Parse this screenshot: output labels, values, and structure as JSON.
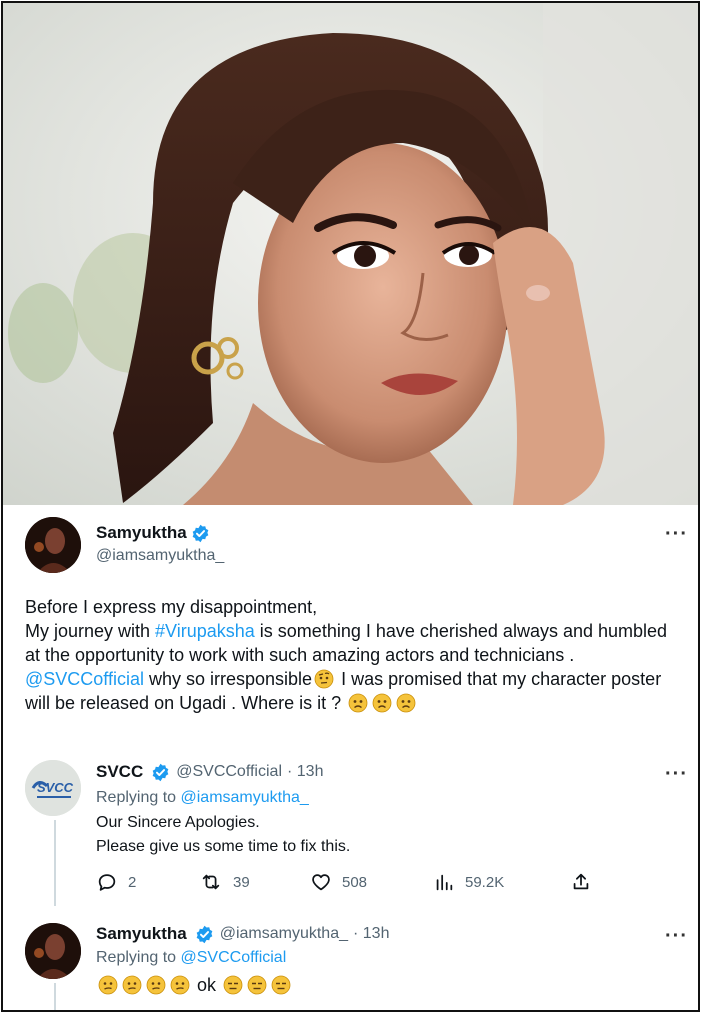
{
  "photo": {
    "alt_icon": "portrait-photo"
  },
  "main_tweet": {
    "author_name": "Samyuktha",
    "author_handle": "@iamsamyuktha_",
    "line1": "Before I express my disappointment,",
    "line2_prefix": "My journey with ",
    "hashtag": "#Virupaksha",
    "line2_suffix": " is something I have cherished always and humbled at the opportunity to work with such amazing actors and technicians .",
    "mention": "@SVCCofficial",
    "line3_a": " why so irresponsible",
    "line3_b": " I was promised that my character poster will be released on Ugadi . Where is it ? "
  },
  "reply1": {
    "author_name": "SVCC",
    "author_handle": "@SVCCofficial",
    "time": "· 13h",
    "replying_label": "Replying to ",
    "replying_handle": "@iamsamyuktha_",
    "text1": "Our Sincere Apologies.",
    "text2": "Please give us some time to fix this.",
    "avatar_text": "SVCC"
  },
  "actions": {
    "replies": "2",
    "retweets": "39",
    "likes": "508",
    "views": "59.2K"
  },
  "reply2": {
    "author_name": "Samyuktha",
    "author_handle": "@iamsamyuktha_",
    "time": "· 13h",
    "replying_label": "Replying to ",
    "replying_handle": "@SVCCofficial",
    "text_ok": "ok"
  },
  "more_label": "···",
  "colors": {
    "link": "#1d9bf0",
    "verified": "#1d9bf0",
    "muted": "#536471"
  }
}
